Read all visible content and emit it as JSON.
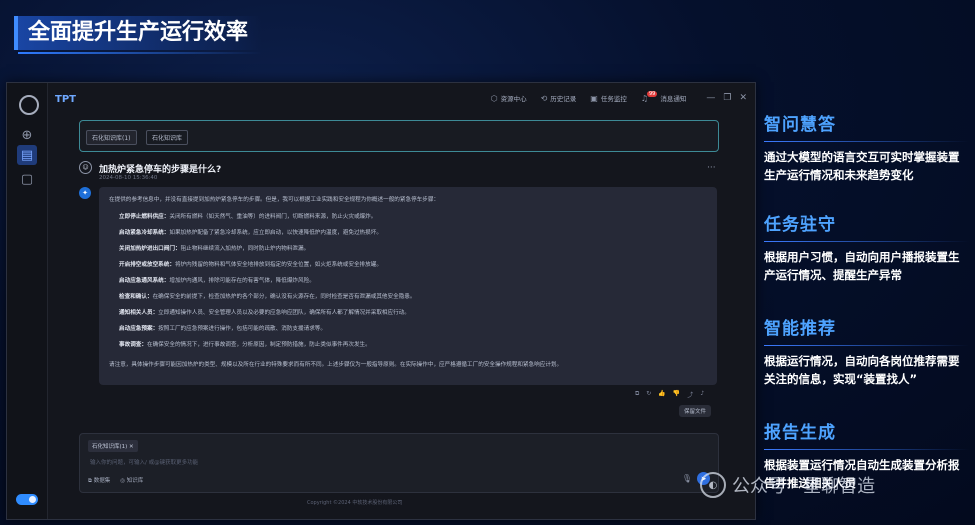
{
  "slide_title": "全面提升生产运行效率",
  "app": {
    "brand": "TPT",
    "topbar": [
      {
        "icon": "cube-icon",
        "label": "资源中心"
      },
      {
        "icon": "history-icon",
        "label": "历史记录"
      },
      {
        "icon": "task-icon",
        "label": "任务监控"
      },
      {
        "icon": "bell-icon",
        "label": "消息通知",
        "badge": "99"
      }
    ],
    "kb_chip_selected": "石化知识库(1)",
    "kb_chip_other": "石化知识库",
    "question": "加热炉紧急停车的步骤是什么?",
    "question_time": "2024-08-10 15:36:40",
    "answer": {
      "intro": "在提供的参考信息中，并没有直接提到加热炉紧急停车的步骤。但是，我可以根据工业实践和安全规程为你概述一般的紧急停车步骤：",
      "steps": [
        {
          "k": "立即停止燃料供应：",
          "v": "关闭所有燃料（如天然气、重油等）的进料阀门，切断燃料来源，防止火灾或爆炸。"
        },
        {
          "k": "启动紧急冷却系统：",
          "v": "如果加热炉配备了紧急冷却系统，应立即启动，以快速降低炉内温度，避免过热损坏。"
        },
        {
          "k": "关闭加热炉进出口阀门：",
          "v": "阻止物料继续流入加热炉，同时防止炉内物料泄漏。"
        },
        {
          "k": "开启排空或放空系统：",
          "v": "将炉内残留的物料和气体安全地排放到指定的安全位置，如火炬系统或安全排放罐。"
        },
        {
          "k": "启动应急通风系统：",
          "v": "增加炉内通风，排除可能存在的有害气体，降低爆炸风险。"
        },
        {
          "k": "检查和确认：",
          "v": "在确保安全的前提下，检查加热炉的各个部分，确认没有火源存在，同时检查是否有泄漏或其他安全隐患。"
        },
        {
          "k": "通知相关人员：",
          "v": "立即通知操作人员、安全管理人员以及必要的应急响应团队，确保所有人都了解情况并采取相应行动。"
        },
        {
          "k": "启动应急预案：",
          "v": "按照工厂的应急预案进行操作，包括可能的疏散、消防支援请求等。"
        },
        {
          "k": "事故调查：",
          "v": "在确保安全的情况下，进行事故调查，分析原因，制定预防措施，防止类似事件再次发生。"
        }
      ],
      "closing": "请注意，具体操作步骤可能因加热炉的类型、规模以及所在行业的特殊要求而有所不同。上述步骤仅为一般指导原则。在实际操作中，应严格遵循工厂的安全操作规程和紧急响应计划。"
    },
    "reserve_label": "保留文件",
    "composer": {
      "chip": "石化知识库(1)",
      "placeholder": "输入你的问题，可输入/ 或@键获取更多功能",
      "tool1": "数据集",
      "tool2": "知识库"
    },
    "copyright": "Copyright ©2024 中软技术股份有限公司"
  },
  "features": [
    {
      "title": "智问慧答",
      "desc": "通过大模型的语言交互可实时掌握装置生产运行情况和未来趋势变化"
    },
    {
      "title": "任务驻守",
      "desc": "根据用户习惯，自动向用户播报装置生产运行情况、提醒生产异常"
    },
    {
      "title": "智能推荐",
      "desc": "根据运行情况，自动向各岗位推荐需要关注的信息，实现“装置找人”"
    },
    {
      "title": "报告生成",
      "desc": "根据装置运行情况自动生成装置分析报告并推送相关人员"
    }
  ],
  "watermark": "公众号 · 星聊智造"
}
